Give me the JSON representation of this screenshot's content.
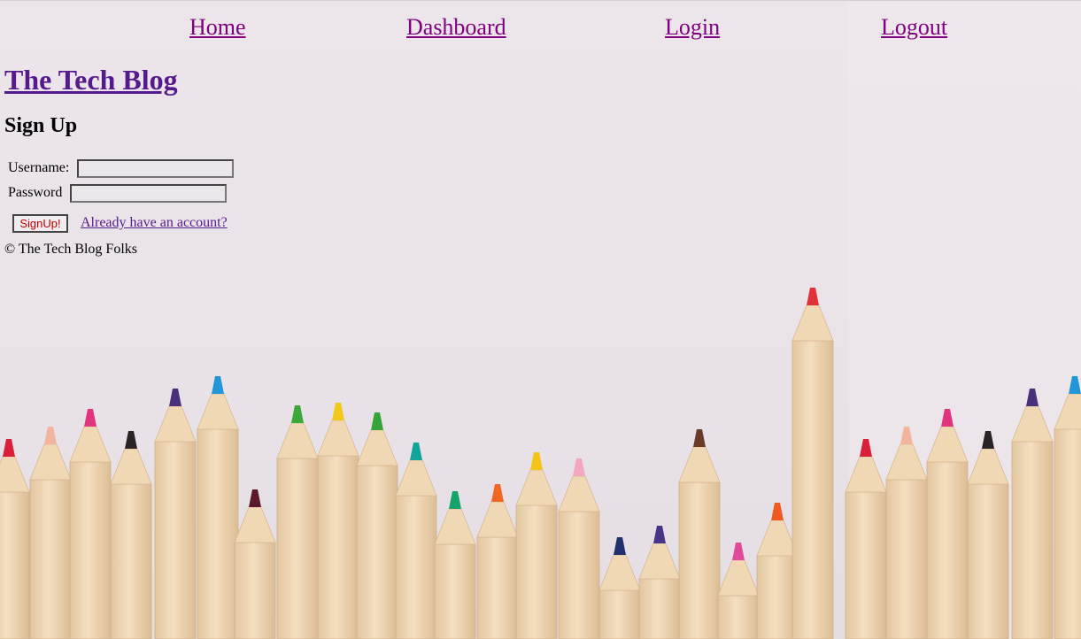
{
  "nav": {
    "links": [
      {
        "label": "Home"
      },
      {
        "label": "Dashboard"
      },
      {
        "label": "Login"
      },
      {
        "label": "Logout"
      }
    ]
  },
  "site": {
    "title": "The Tech Blog"
  },
  "signup": {
    "heading": "Sign Up",
    "username_label": "Username:",
    "username_value": "",
    "password_label": "Password",
    "password_value": "",
    "submit_label": "SignUp!",
    "login_link": "Already have an account?"
  },
  "footer": {
    "text": "© The Tech Blog Folks"
  },
  "colors": {
    "visited_link": "#800080",
    "link": "#551a8b",
    "button_text": "#c00000",
    "background": "#ebe4e9"
  }
}
